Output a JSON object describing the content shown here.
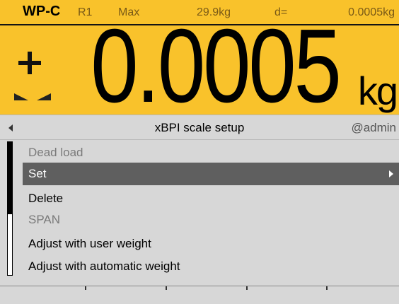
{
  "header": {
    "device_name": "WP-C",
    "range": "R1",
    "max_label": "Max",
    "max_value": "29.9kg",
    "d_label": "d=",
    "d_value": "0.0005kg",
    "background_color": "#f9c22b"
  },
  "weight": {
    "sign": "+",
    "value": "0.0005",
    "unit": "kg",
    "stability_icon": "stable-standstill-icon"
  },
  "title_bar": {
    "back_icon": "left-arrow-icon",
    "title": "xBPI scale setup",
    "user": "@admin"
  },
  "menu": {
    "items": [
      {
        "label": "Dead load",
        "state": "disabled"
      },
      {
        "label": "Set",
        "state": "selected",
        "has_submenu": true
      },
      {
        "label": "Delete",
        "state": "normal"
      },
      {
        "label": "SPAN",
        "state": "disabled"
      },
      {
        "label": "Adjust with user weight",
        "state": "normal"
      },
      {
        "label": "Adjust with automatic weight",
        "state": "normal"
      }
    ],
    "selected_color": "#5f5f5f"
  },
  "softkeys": {
    "labels": [
      "",
      "",
      "",
      "",
      ""
    ]
  }
}
